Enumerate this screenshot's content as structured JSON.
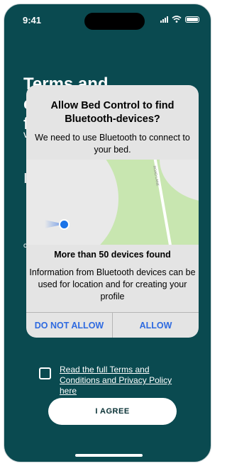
{
  "status_bar": {
    "time": "9:41"
  },
  "background": {
    "title": "Terms and conditions",
    "title_cont": "f",
    "frag1": "v",
    "frag2": "I",
    "frag3": "c"
  },
  "dialog": {
    "title": "Allow Bed Control to find Bluetooth-devices?",
    "message": "We need to use Bluetooth to connect to your bed.",
    "map_road_label": "ROAD LANE",
    "found": "More than 50 devices found",
    "info": "Information from Bluetooth devices can be used for location and for creating your profile",
    "deny_label": "DO NOT ALLOW",
    "allow_label": "ALLOW"
  },
  "terms": {
    "link_text": "Read the full Terms and Conditions and Privacy Policy here",
    "agree_label": "I AGREE"
  }
}
